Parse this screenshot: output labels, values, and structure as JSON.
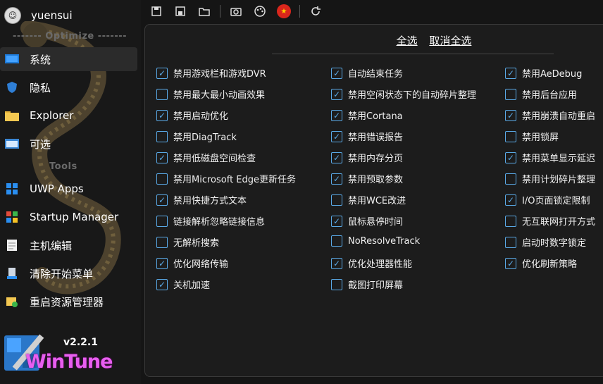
{
  "user": {
    "name": "yuensui"
  },
  "sections": {
    "optimize": "------- Optimize -------",
    "tools": "Tools"
  },
  "nav": [
    {
      "label": "系统",
      "icon": "monitor-icon"
    },
    {
      "label": "隐私",
      "icon": "shield-icon"
    },
    {
      "label": "Explorer",
      "icon": "folder-icon"
    },
    {
      "label": "可选",
      "icon": "settings-window-icon"
    },
    {
      "label": "UWP Apps",
      "icon": "windows-icon"
    },
    {
      "label": "Startup Manager",
      "icon": "startup-icon"
    },
    {
      "label": "主机编辑",
      "icon": "notepad-icon"
    },
    {
      "label": "清除开始菜单",
      "icon": "clean-icon"
    },
    {
      "label": "重启资源管理器",
      "icon": "restart-explorer-icon"
    }
  ],
  "app": {
    "version": "v2.2.1",
    "logo_text": "WinTune"
  },
  "toolbar": [
    {
      "name": "save-icon",
      "glyph": "🖫"
    },
    {
      "name": "save-all-icon",
      "glyph": "🖬"
    },
    {
      "name": "open-folder-icon",
      "glyph": "🗁"
    },
    {
      "name": "screenshot-icon",
      "glyph": "📷"
    },
    {
      "name": "theme-palette-icon",
      "glyph": "🎨"
    },
    {
      "name": "language-flag-icon",
      "glyph": "★"
    },
    {
      "name": "refresh-icon",
      "glyph": "⟳"
    }
  ],
  "actions": {
    "select_all": "全选",
    "deselect_all": "取消全选"
  },
  "options": [
    [
      {
        "label": "禁用游戏栏和游戏DVR",
        "checked": true
      },
      {
        "label": "禁用最大最小动画效果",
        "checked": false
      },
      {
        "label": "禁用启动优化",
        "checked": true
      },
      {
        "label": "禁用DiagTrack",
        "checked": false
      },
      {
        "label": "禁用低磁盘空间检查",
        "checked": true
      },
      {
        "label": "禁用Microsoft Edge更新任务",
        "checked": false
      },
      {
        "label": "禁用快捷方式文本",
        "checked": true
      },
      {
        "label": "链接解析忽略链接信息",
        "checked": false
      },
      {
        "label": "无解析搜索",
        "checked": false
      },
      {
        "label": "优化网络传输",
        "checked": true
      },
      {
        "label": "关机加速",
        "checked": true
      }
    ],
    [
      {
        "label": "自动结束任务",
        "checked": true
      },
      {
        "label": "禁用空闲状态下的自动碎片整理",
        "checked": true
      },
      {
        "label": "禁用Cortana",
        "checked": true
      },
      {
        "label": "禁用错误报告",
        "checked": true
      },
      {
        "label": "禁用内存分页",
        "checked": true
      },
      {
        "label": "禁用预取参数",
        "checked": true
      },
      {
        "label": "禁用WCE改进",
        "checked": false
      },
      {
        "label": "鼠标悬停时间",
        "checked": true
      },
      {
        "label": "NoResolveTrack",
        "checked": false
      },
      {
        "label": "优化处理器性能",
        "checked": true
      },
      {
        "label": "截图打印屏幕",
        "checked": false
      }
    ],
    [
      {
        "label": "禁用AeDebug",
        "checked": true
      },
      {
        "label": "禁用后台应用",
        "checked": false
      },
      {
        "label": "禁用崩溃自动重启",
        "checked": true
      },
      {
        "label": "禁用锁屏",
        "checked": false
      },
      {
        "label": "禁用菜单显示延迟",
        "checked": true
      },
      {
        "label": "禁用计划碎片整理",
        "checked": false
      },
      {
        "label": "I/O页面锁定限制",
        "checked": true
      },
      {
        "label": "无互联网打开方式",
        "checked": false
      },
      {
        "label": "启动时数字锁定",
        "checked": false
      },
      {
        "label": "优化刷新策略",
        "checked": true
      }
    ]
  ],
  "colors": {
    "accent": "#5aa9e6",
    "background": "#151515",
    "panel": "#1c1c1c"
  }
}
